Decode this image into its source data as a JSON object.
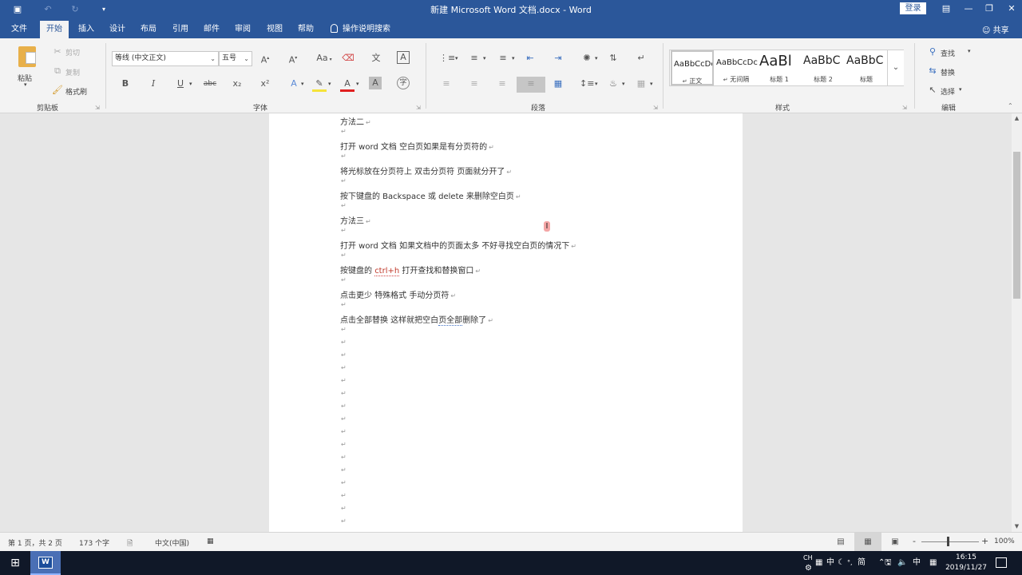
{
  "titlebar": {
    "title": "新建 Microsoft Word 文档.docx - Word",
    "login_label": "登录",
    "save_icon": "save-icon",
    "undo_icon": "undo-icon",
    "redo_icon": "redo-icon",
    "customize_icon": "customize-quick-access-icon",
    "window_controls": [
      "ribbon-display-icon",
      "minimize-icon",
      "restore-icon",
      "close-icon"
    ]
  },
  "tabs": {
    "items": [
      "文件",
      "开始",
      "插入",
      "设计",
      "布局",
      "引用",
      "邮件",
      "审阅",
      "视图",
      "帮助"
    ],
    "active": "开始",
    "tell_me": "操作说明搜索",
    "share": "共享"
  },
  "ribbon": {
    "clipboard": {
      "label": "剪贴板",
      "paste": "粘贴",
      "cut": "剪切",
      "copy": "复制",
      "format_painter": "格式刷"
    },
    "font": {
      "label": "字体",
      "font_name": "等线 (中文正文)",
      "font_size": "五号",
      "grow": "A",
      "shrink": "A",
      "change_case": "Aa",
      "phonetic": "文",
      "char_border": "A",
      "bold": "B",
      "italic": "I",
      "underline": "U",
      "strikethrough": "abc",
      "subscript": "x₂",
      "superscript": "x²",
      "text_effects": "A",
      "font_color": "A",
      "char_shading": "A",
      "enclosed": "字"
    },
    "paragraph": {
      "label": "段落"
    },
    "styles": {
      "label": "样式",
      "items": [
        {
          "sample": "AaBbCcDc",
          "name": "正文"
        },
        {
          "sample": "AaBbCcDc",
          "name": "无间隔"
        },
        {
          "sample": "AaBl",
          "name": "标题 1"
        },
        {
          "sample": "AaBbC",
          "name": "标题 2"
        },
        {
          "sample": "AaBbC",
          "name": "标题"
        }
      ]
    },
    "editing": {
      "label": "编辑",
      "find": "查找",
      "replace": "替换",
      "select": "选择"
    }
  },
  "document": {
    "lines": [
      "方法二",
      "打开 word 文档  空白页如果是有分页符的",
      "将光标放在分页符上  双击分页符  页面就分开了",
      "按下键盘的 Backspace 或 delete 来删除空白页",
      "方法三",
      "打开 word 文档  如果文档中的页面太多  不好寻找空白页的情况下",
      "按键盘的 ",
      "ctrl+h",
      " 打开查找和替换窗口",
      "点击更少  特殊格式  手动分页符",
      "点击全部替换  这样就把空白",
      "页全部",
      "删除了"
    ]
  },
  "statusbar": {
    "page": "第 1 页，共 2 页",
    "words": "173 个字",
    "language": "中文(中国)",
    "zoom": "100%",
    "zoom_minus": "-",
    "zoom_plus": "+"
  },
  "taskbar": {
    "ime_ch": "CH",
    "ime_mode": "中",
    "ime_simplified": "简",
    "lang": "中",
    "time": "16:15",
    "date": "2019/11/27"
  }
}
